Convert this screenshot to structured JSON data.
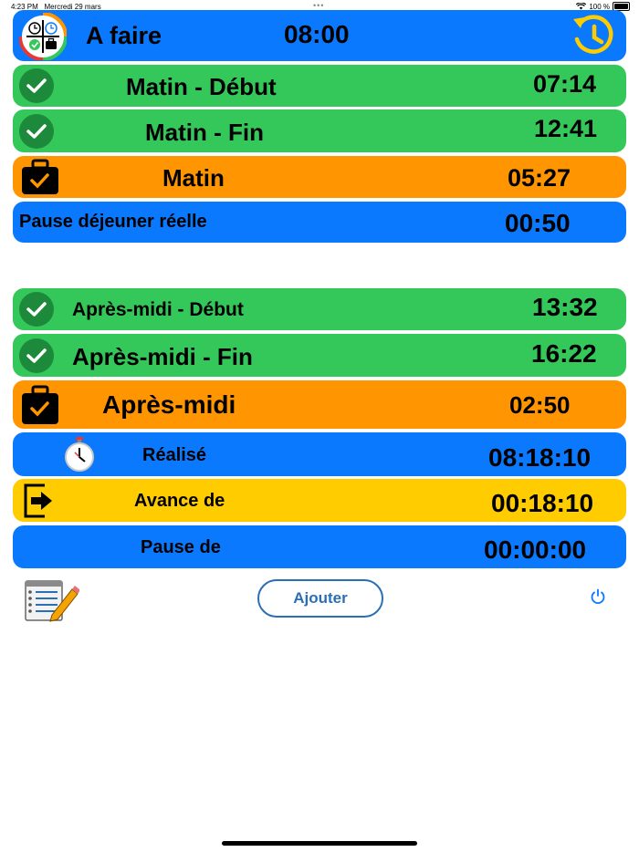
{
  "status_bar": {
    "time": "4:23 PM",
    "date": "Mercredi 29 mars",
    "battery": "100 %"
  },
  "header": {
    "title": "A faire",
    "target_time": "08:00",
    "app_icon": "app-logo-icon",
    "history_icon": "history-clock-icon"
  },
  "morning": {
    "start": {
      "label": "Matin - Début",
      "time": "07:14"
    },
    "end": {
      "label": "Matin - Fin",
      "time": "12:41"
    },
    "total": {
      "label": "Matin",
      "time": "05:27"
    },
    "lunch": {
      "label": "Pause déjeuner réelle",
      "time": "00:50"
    }
  },
  "afternoon": {
    "start": {
      "label": "Après-midi - Début",
      "time": "13:32"
    },
    "end": {
      "label": "Après-midi - Fin",
      "time": "16:22"
    },
    "total": {
      "label": "Après-midi",
      "time": "02:50"
    }
  },
  "summary": {
    "done": {
      "label": "Réalisé",
      "time": "08:18:10"
    },
    "ahead": {
      "label": "Avance de",
      "time": "00:18:10"
    },
    "pause": {
      "label": "Pause de",
      "time": "00:00:00"
    }
  },
  "toolbar": {
    "add_label": "Ajouter"
  },
  "colors": {
    "blue": "#0a79fd",
    "green": "#34c759",
    "orange": "#ff9500",
    "yellow": "#ffcc00"
  }
}
